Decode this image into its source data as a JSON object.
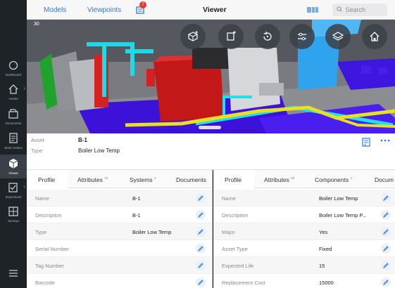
{
  "topbar": {
    "models_label": "Models",
    "viewpoints_label": "Viewpoints",
    "notification_count": "7",
    "title": "Viewer",
    "search_placeholder": "Search"
  },
  "viewport": {
    "fps": "30"
  },
  "sidebar": {
    "items": [
      {
        "label": "Dashboard",
        "icon": "circle-icon"
      },
      {
        "label": "Assets",
        "icon": "house-icon"
      },
      {
        "label": "Documents",
        "icon": "documents-icon"
      },
      {
        "label": "Work Orders",
        "icon": "work-orders-icon"
      },
      {
        "label": "Viewer",
        "icon": "cube-icon"
      },
      {
        "label": "Inspections",
        "icon": "inspection-icon"
      },
      {
        "label": "Surveys",
        "icon": "survey-icon"
      }
    ]
  },
  "asset": {
    "asset_label": "Asset",
    "asset_value": "B-1",
    "type_label": "Type",
    "type_value": "Boiler Low Temp"
  },
  "left_panel": {
    "tabs": [
      {
        "label": "Profile",
        "count": ""
      },
      {
        "label": "Attributes",
        "count": "10"
      },
      {
        "label": "Systems",
        "count": "2"
      },
      {
        "label": "Documents",
        "count": ""
      }
    ],
    "rows": [
      {
        "label": "Name",
        "value": "B-1"
      },
      {
        "label": "Description",
        "value": "B-1"
      },
      {
        "label": "Type",
        "value": "Boiler Low Temp"
      },
      {
        "label": "Serial Number",
        "value": ""
      },
      {
        "label": "Tag Number",
        "value": ""
      },
      {
        "label": "Barcode",
        "value": ""
      }
    ]
  },
  "right_panel": {
    "tabs": [
      {
        "label": "Profile",
        "count": ""
      },
      {
        "label": "Attributes",
        "count": "58"
      },
      {
        "label": "Components",
        "count": "2"
      },
      {
        "label": "Docum",
        "count": ""
      }
    ],
    "rows": [
      {
        "label": "Name",
        "value": "Boiler Low Temp"
      },
      {
        "label": "Description",
        "value": "Boiler Low Temp P..."
      },
      {
        "label": "Major",
        "value": "Yes"
      },
      {
        "label": "Asset Type",
        "value": "Fixed"
      },
      {
        "label": "Expected Life",
        "value": "15"
      },
      {
        "label": "Replacement Cost",
        "value": "15000"
      }
    ]
  },
  "colors": {
    "accent": "#2a7bd4",
    "sidebar": "#1e2328",
    "badge": "#e53935"
  }
}
